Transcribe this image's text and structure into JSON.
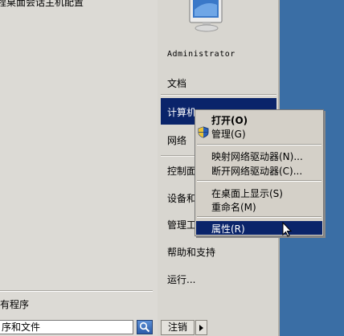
{
  "left": {
    "top_label": "程桌面会话主机配置",
    "all_programs": "有程序",
    "search_value": "序和文件"
  },
  "right": {
    "user_name": "Administrator",
    "items": [
      "文档",
      "计算机",
      "网络",
      "控制面",
      "设备和",
      "管理工",
      "帮助和支持",
      "运行..."
    ],
    "logoff": "注销"
  },
  "context_menu": {
    "items": [
      {
        "label": "打开(O)",
        "bold": true
      },
      {
        "label": "管理(G)",
        "icon": "uac-shield-icon"
      },
      {
        "label": "映射网络驱动器(N)..."
      },
      {
        "label": "断开网络驱动器(C)..."
      },
      {
        "label": "在桌面上显示(S)"
      },
      {
        "label": "重命名(M)"
      },
      {
        "label": "属性(R)",
        "highlighted": true
      }
    ]
  },
  "colors": {
    "desktop": "#3a6ea5",
    "highlight": "#0a246a",
    "menu_bg": "#d4d0c8"
  }
}
